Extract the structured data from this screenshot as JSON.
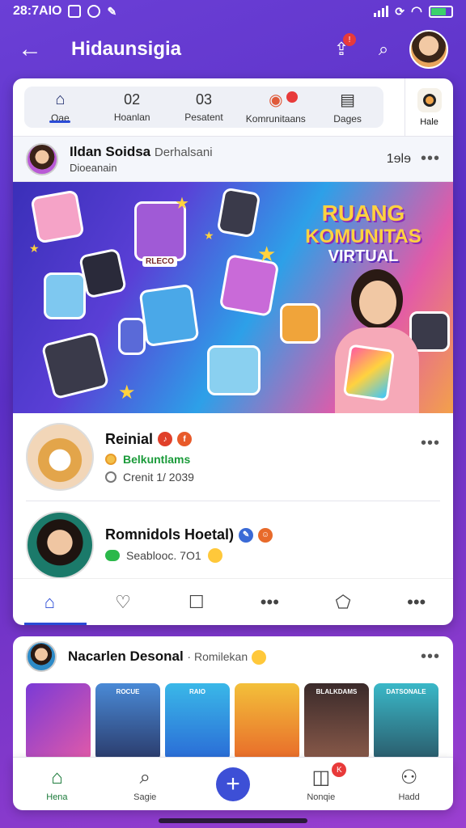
{
  "status_bar": {
    "time": "28:7AIO"
  },
  "appbar": {
    "title": "Hidaunsigia"
  },
  "tabs": [
    {
      "label": "Oae",
      "icon": "home-icon",
      "active": true
    },
    {
      "number": "02",
      "label": "Hoanlan"
    },
    {
      "number": "03",
      "label": "Pesatent"
    },
    {
      "label": "Komrunitaans",
      "badge": true
    },
    {
      "label": "Dages"
    }
  ],
  "side_tab": {
    "label": "Hale"
  },
  "pinned": {
    "name": "Ildan Soidsa",
    "name_suffix": "Derhalsani",
    "sub": "Dioeanain",
    "count": "1ɘlɘ"
  },
  "banner": {
    "line1": "RUANG",
    "line2": "KOMUNITAS",
    "line3": "VIRTUAL",
    "tag": "RLECO"
  },
  "posts": [
    {
      "name": "Reinial",
      "line1": "Belkuntlams",
      "line2": "Crenit 1/ 2039",
      "line1_color": "#1b9b3a"
    },
    {
      "name": "Romnidols Hoetal)",
      "line1": "Seablooc. 7O1"
    }
  ],
  "actions": [
    {
      "icon": "home-icon",
      "active": true
    },
    {
      "icon": "heart-icon"
    },
    {
      "icon": "chat-bubble-icon"
    },
    {
      "icon": "more-icon"
    },
    {
      "icon": "share-icon"
    },
    {
      "icon": "more-icon"
    }
  ],
  "stories_section": {
    "title": "Nacarlen Desonal",
    "subtitle": "· Romilekan",
    "stories": [
      {
        "caption": ""
      },
      {
        "caption": "ROCUE"
      },
      {
        "caption": "RAIO"
      },
      {
        "caption": ""
      },
      {
        "caption": "Blalkdams"
      },
      {
        "caption": "Datsonale"
      }
    ]
  },
  "bottom_nav": [
    {
      "label": "Hena",
      "icon": "home-icon",
      "active": true
    },
    {
      "label": "Sagie",
      "icon": "search-icon"
    },
    {
      "label": "",
      "icon": "plus-icon"
    },
    {
      "label": "Nonqie",
      "icon": "notification-icon",
      "badge": "K"
    },
    {
      "label": "Hadd",
      "icon": "profile-icon"
    }
  ],
  "colors": {
    "accent": "#3d4fd6",
    "active_nav": "#1b7a3a",
    "gradient_start": "#6b3fd6"
  }
}
